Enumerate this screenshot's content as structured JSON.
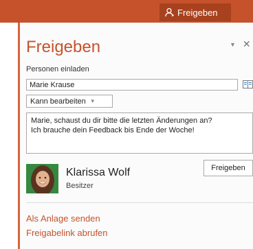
{
  "header": {
    "share_label": "Freigeben"
  },
  "pane": {
    "title": "Freigeben",
    "invite_label": "Personen einladen",
    "name_value": "Marie Krause",
    "permission_value": "Kann bearbeiten",
    "message": "Marie, schaust du dir bitte die letzten Änderungen an?\nIch brauche dein Feedback bis Ende der Woche!",
    "share_button": "Freigeben",
    "owner": {
      "name": "Klarissa Wolf",
      "role": "Besitzer"
    },
    "links": {
      "attachment": "Als Anlage senden",
      "share_link": "Freigabelink abrufen"
    }
  },
  "colors": {
    "accent": "#c6522c",
    "accent_dark": "#a8411e"
  }
}
